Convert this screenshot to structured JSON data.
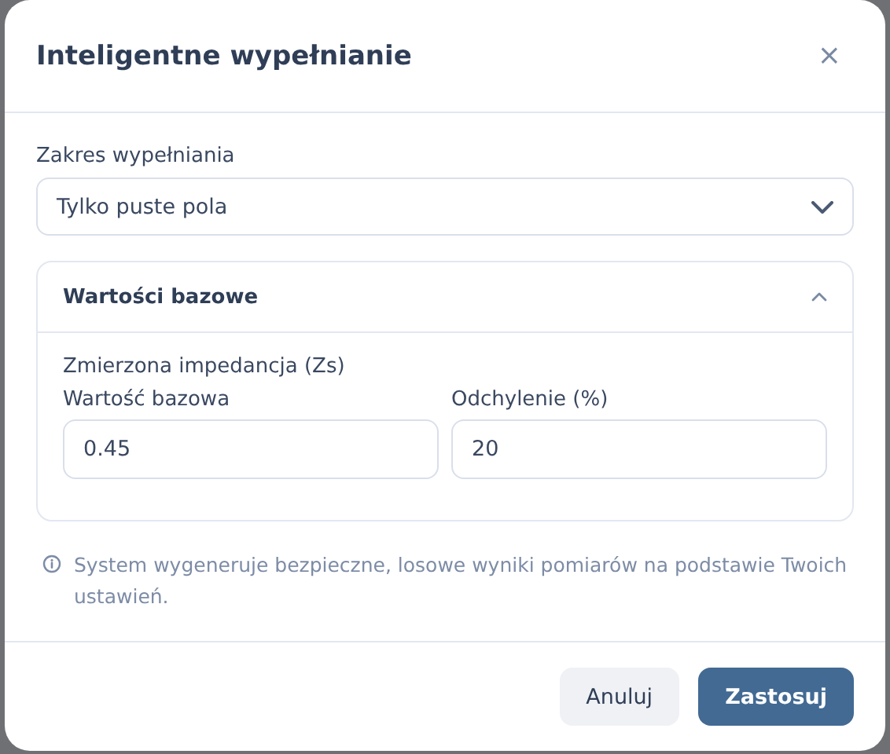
{
  "dialog": {
    "title": "Inteligentne wypełnianie",
    "close_label": "×"
  },
  "fill_range": {
    "label": "Zakres wypełniania",
    "value": "Tylko puste pola"
  },
  "section": {
    "title": "Wartości bazowe",
    "expanded": true,
    "group_label": "Zmierzona impedancja (Zs)",
    "fields": [
      {
        "label": "Wartość bazowa",
        "value": "0.45"
      },
      {
        "label": "Odchylenie (%)",
        "value": "20"
      }
    ]
  },
  "info": "System wygeneruje bezpieczne, losowe wyniki pomiarów na podstawie Twoich ustawień.",
  "buttons": [
    {
      "label": "Anuluj",
      "kind": "secondary"
    },
    {
      "label": "Zastosuj",
      "kind": "primary"
    }
  ]
}
